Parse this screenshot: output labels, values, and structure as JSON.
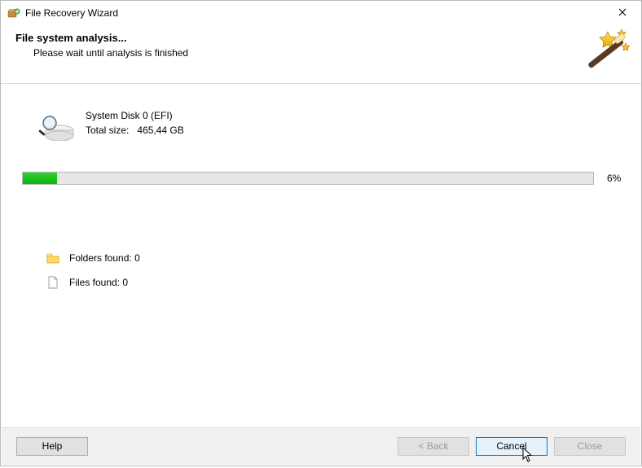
{
  "window": {
    "title": "File Recovery Wizard"
  },
  "header": {
    "heading": "File system analysis...",
    "subheading": "Please wait until analysis is finished"
  },
  "disk": {
    "name": "System Disk 0 (EFI)",
    "size_label": "Total size:",
    "size_value": "465,44 GB"
  },
  "progress": {
    "percent": 6,
    "percent_label": "6%"
  },
  "found": {
    "folders_label": "Folders found:",
    "folders_count": 0,
    "files_label": "Files found:",
    "files_count": 0
  },
  "buttons": {
    "help": "Help",
    "back": "< Back",
    "cancel": "Cancel",
    "close": "Close"
  },
  "colors": {
    "progress_fill": "#17c617",
    "primary_border": "#0078d7"
  }
}
